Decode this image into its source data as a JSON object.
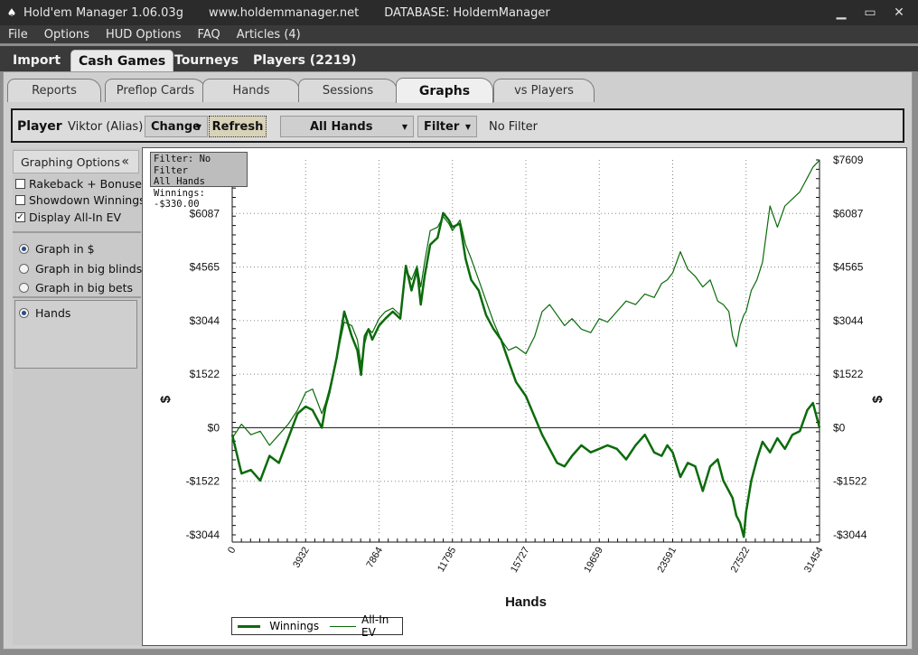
{
  "window": {
    "title": "Hold'em Manager 1.06.03g",
    "url": "www.holdemmanager.net",
    "database": "DATABASE: HoldemManager"
  },
  "menu": [
    "File",
    "Options",
    "HUD Options",
    "FAQ",
    "Articles (4)"
  ],
  "main_tabs": [
    "Import",
    "Cash Games",
    "Tourneys",
    "Players (2219)"
  ],
  "sub_tabs": [
    "Reports",
    "Preflop Cards",
    "Hands",
    "Sessions",
    "Graphs",
    "vs Players"
  ],
  "playerbar": {
    "player_label": "Player",
    "player_name": "Viktor (Alias)",
    "change": "Change",
    "refresh": "Refresh",
    "hands_filter": "All Hands",
    "filter": "Filter",
    "filter_status": "No Filter"
  },
  "sidebar": {
    "header": "Graphing Options",
    "collapse": "«",
    "checks": [
      {
        "label": "Rakeback + Bonuses",
        "checked": false
      },
      {
        "label": "Showdown Winnings",
        "checked": false
      },
      {
        "label": "Display All-In EV",
        "checked": true
      }
    ],
    "radios": [
      {
        "label": "Graph in $",
        "selected": true
      },
      {
        "label": "Graph in big blinds",
        "selected": false
      },
      {
        "label": "Graph in big bets",
        "selected": false
      }
    ],
    "xaxis_option": {
      "label": "Hands",
      "selected": true
    }
  },
  "graph": {
    "filter_box": [
      "Filter: No Filter",
      "All Hands",
      "Winnings: -$330.00"
    ],
    "legend": [
      "Winnings",
      "All-In EV"
    ]
  },
  "chart_data": {
    "type": "line",
    "xlabel": "Hands",
    "ylabel": "$",
    "x_ticks": [
      "0",
      "3932",
      "7864",
      "11795",
      "15727",
      "19659",
      "23591",
      "27522",
      "31454"
    ],
    "y_ticks": [
      "$7609",
      "$6087",
      "$4565",
      "$3044",
      "$1522",
      "$0",
      "-$1522",
      "-$3044"
    ],
    "xlim": [
      0,
      31454
    ],
    "ylim": [
      -3044,
      7609
    ],
    "grid": true,
    "legend_position": "bottom-left",
    "series": [
      {
        "name": "Winnings",
        "color": "#0b6b0b",
        "x": [
          0,
          500,
          1000,
          1500,
          2000,
          2500,
          3000,
          3500,
          3932,
          4300,
          4800,
          5000,
          5200,
          5600,
          6000,
          6400,
          6700,
          6900,
          7100,
          7300,
          7500,
          7864,
          8200,
          8600,
          9000,
          9300,
          9600,
          9900,
          10100,
          10300,
          10600,
          11000,
          11300,
          11600,
          11795,
          12200,
          12500,
          12800,
          13200,
          13600,
          14000,
          14400,
          14800,
          15200,
          15727,
          16200,
          16600,
          17000,
          17400,
          17800,
          18200,
          18700,
          19200,
          19659,
          20100,
          20600,
          21100,
          21600,
          22100,
          22600,
          23000,
          23300,
          23591,
          24000,
          24400,
          24800,
          25200,
          25600,
          26000,
          26300,
          26600,
          26800,
          27000,
          27200,
          27400,
          27522,
          27800,
          28100,
          28400,
          28800,
          29200,
          29600,
          30000,
          30400,
          30800,
          31100,
          31454
        ],
        "y": [
          -200,
          -1300,
          -1200,
          -1500,
          -800,
          -1000,
          -300,
          400,
          600,
          500,
          0,
          600,
          1000,
          2000,
          3300,
          2600,
          2200,
          1500,
          2600,
          2800,
          2500,
          2900,
          3100,
          3300,
          3100,
          4600,
          3900,
          4500,
          3500,
          4300,
          5200,
          5400,
          6100,
          5900,
          5700,
          5800,
          4800,
          4200,
          3900,
          3200,
          2800,
          2500,
          1900,
          1300,
          900,
          300,
          -200,
          -600,
          -1000,
          -1100,
          -800,
          -500,
          -700,
          -600,
          -500,
          -600,
          -900,
          -500,
          -200,
          -700,
          -800,
          -500,
          -700,
          -1400,
          -1000,
          -1100,
          -1800,
          -1100,
          -900,
          -1500,
          -1800,
          -2000,
          -2500,
          -2700,
          -3100,
          -2400,
          -1500,
          -900,
          -400,
          -700,
          -300,
          -600,
          -200,
          -100,
          500,
          700,
          0
        ]
      },
      {
        "name": "All-In EV",
        "color": "#0b6b0b",
        "x": [
          0,
          500,
          1000,
          1500,
          2000,
          2500,
          3000,
          3500,
          3932,
          4300,
          4800,
          5000,
          5200,
          5600,
          6000,
          6400,
          6700,
          6900,
          7100,
          7300,
          7500,
          7864,
          8200,
          8600,
          9000,
          9300,
          9600,
          9900,
          10100,
          10300,
          10600,
          11000,
          11300,
          11600,
          11795,
          12200,
          12500,
          12800,
          13200,
          13600,
          14000,
          14400,
          14800,
          15200,
          15727,
          16200,
          16600,
          17000,
          17400,
          17800,
          18200,
          18700,
          19200,
          19659,
          20100,
          20600,
          21100,
          21600,
          22100,
          22600,
          23000,
          23300,
          23591,
          24000,
          24400,
          24800,
          25200,
          25600,
          26000,
          26300,
          26600,
          26800,
          27000,
          27200,
          27400,
          27522,
          27800,
          28100,
          28400,
          28800,
          29200,
          29600,
          30000,
          30400,
          30800,
          31100,
          31454
        ],
        "y": [
          -300,
          100,
          -200,
          -100,
          -500,
          -200,
          100,
          500,
          1000,
          1100,
          400,
          700,
          1100,
          2000,
          3000,
          2900,
          2500,
          1800,
          2400,
          2800,
          2700,
          3100,
          3300,
          3400,
          3200,
          4500,
          4200,
          4600,
          4000,
          4700,
          5600,
          5700,
          6000,
          5800,
          5600,
          5900,
          5200,
          4800,
          4200,
          3600,
          3000,
          2500,
          2200,
          2300,
          2100,
          2600,
          3300,
          3500,
          3200,
          2900,
          3100,
          2800,
          2700,
          3100,
          3000,
          3300,
          3600,
          3500,
          3800,
          3700,
          4100,
          4200,
          4400,
          5000,
          4500,
          4300,
          4000,
          4200,
          3600,
          3500,
          3300,
          2600,
          2300,
          2900,
          3200,
          3300,
          3900,
          4200,
          4700,
          6300,
          5700,
          6300,
          6500,
          6700,
          7100,
          7400,
          7600
        ]
      }
    ]
  }
}
